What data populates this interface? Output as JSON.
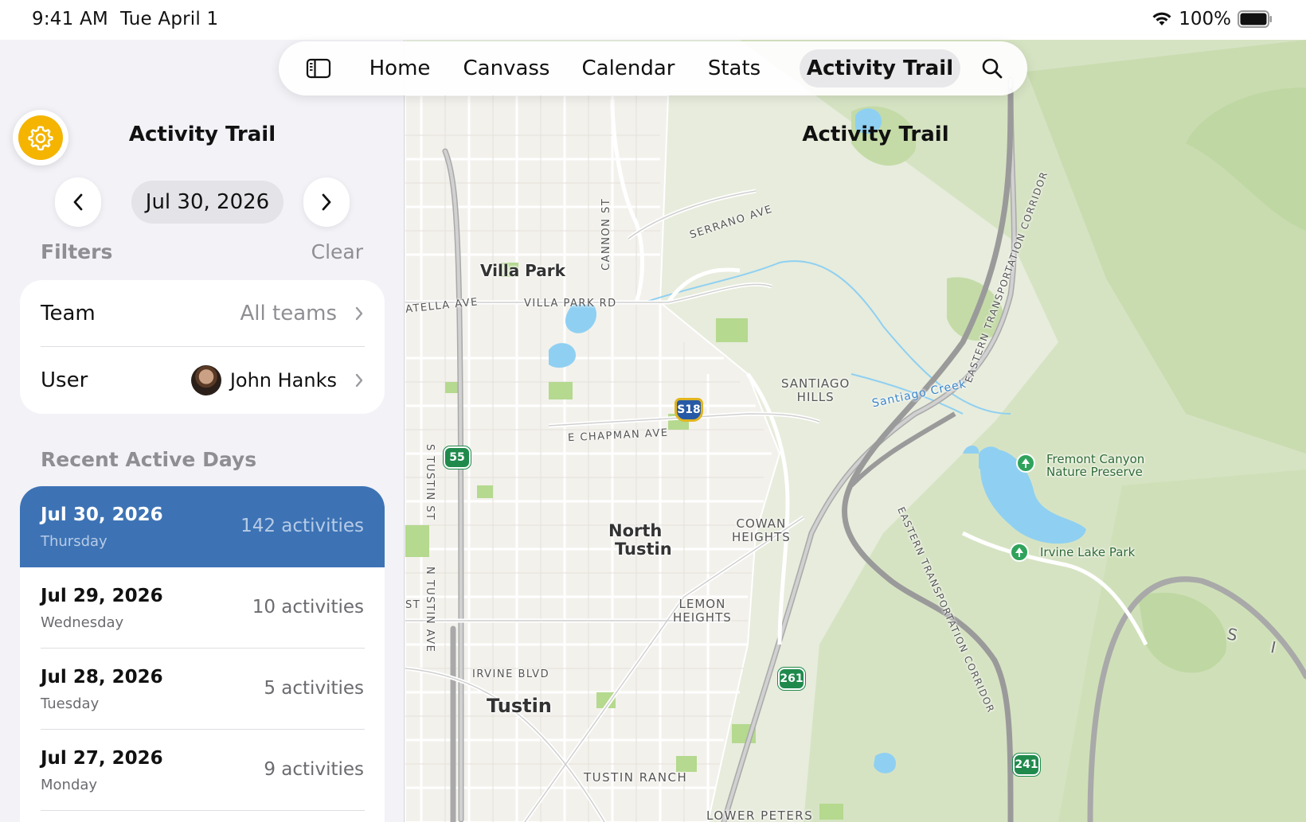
{
  "status_bar": {
    "time": "9:41 AM",
    "date": "Tue April 1",
    "battery": "100%"
  },
  "tabs": {
    "sidebar_toggle_icon": "sidebar-icon",
    "items": [
      "Home",
      "Canvass",
      "Calendar",
      "Stats",
      "Activity Trail"
    ],
    "active": "Activity Trail",
    "search_icon": "search-icon"
  },
  "sidebar": {
    "title": "Activity Trail",
    "settings_icon": "gear-icon",
    "accent_color": "#f4b400",
    "date": "Jul 30, 2026",
    "filters_label": "Filters",
    "clear_label": "Clear",
    "filters": [
      {
        "label": "Team",
        "value": "All teams"
      },
      {
        "label": "User",
        "value": "John Hanks"
      }
    ],
    "recent_label": "Recent Active Days",
    "selected_color": "#3d73b5",
    "days": [
      {
        "date": "Jul 30, 2026",
        "weekday": "Thursday",
        "count": "142 activities",
        "selected": true
      },
      {
        "date": "Jul 29, 2026",
        "weekday": "Wednesday",
        "count": "10 activities",
        "selected": false
      },
      {
        "date": "Jul 28, 2026",
        "weekday": "Tuesday",
        "count": "5 activities",
        "selected": false
      },
      {
        "date": "Jul 27, 2026",
        "weekday": "Monday",
        "count": "9 activities",
        "selected": false
      }
    ]
  },
  "map": {
    "title": "Activity Trail",
    "labels": {
      "villa_park": "Villa Park",
      "north_tustin_1": "North",
      "north_tustin_2": "Tustin",
      "tustin": "Tustin",
      "serrano": "SERRANO AVE",
      "cannon": "CANNON ST",
      "villa_park_rd": "VILLA PARK RD",
      "atella": "ATELLA AVE",
      "chapman": "E CHAPMAN AVE",
      "s_tustin": "S TUSTIN ST",
      "n_tustin": "N TUSTIN AVE",
      "irvine_blvd": "IRVINE BLVD",
      "tustin_ranch": "TUSTIN RANCH",
      "lower_peters": "LOWER PETERS",
      "st": "ST",
      "santiago_hills_1": "SANTIAGO",
      "santiago_hills_2": "HILLS",
      "cowan_1": "COWAN",
      "cowan_2": "HEIGHTS",
      "lemon_1": "LEMON",
      "lemon_2": "HEIGHTS",
      "santiago_creek": "Santiago Creek",
      "etc_1": "EASTERN TRANSPORTATION CORRIDOR",
      "etc_2": "EASTERN TRANSPORTATION CORRIDOR",
      "fremont_1": "Fremont Canyon",
      "fremont_2": "Nature Preserve",
      "irvine_lake": "Irvine Lake Park",
      "s": "S",
      "i": "I"
    },
    "shields": [
      "55",
      "S18",
      "261",
      "241"
    ]
  }
}
